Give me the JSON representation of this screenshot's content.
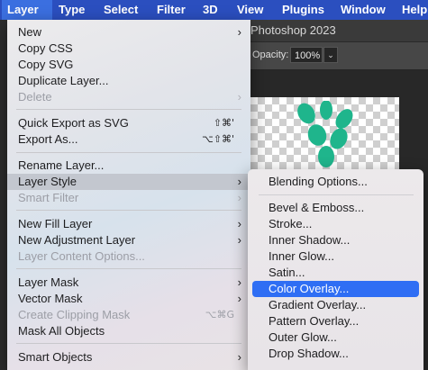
{
  "menubar": {
    "items": [
      "Layer",
      "Type",
      "Select",
      "Filter",
      "3D",
      "View",
      "Plugins",
      "Window",
      "Help"
    ]
  },
  "app": {
    "document_title": "Photoshop 2023",
    "opacity_label": "Opacity:",
    "opacity_value": "100%"
  },
  "layer_menu": {
    "new": "New",
    "copy_css": "Copy CSS",
    "copy_svg": "Copy SVG",
    "duplicate_layer": "Duplicate Layer...",
    "delete": "Delete",
    "quick_export": "Quick Export as SVG",
    "quick_export_shortcut": "⇧⌘'",
    "export_as": "Export As...",
    "export_as_shortcut": "⌥⇧⌘'",
    "rename_layer": "Rename Layer...",
    "layer_style": "Layer Style",
    "smart_filter": "Smart Filter",
    "new_fill_layer": "New Fill Layer",
    "new_adjustment_layer": "New Adjustment Layer",
    "layer_content_options": "Layer Content Options...",
    "layer_mask": "Layer Mask",
    "vector_mask": "Vector Mask",
    "create_clipping_mask": "Create Clipping Mask",
    "create_clipping_mask_shortcut": "⌥⌘G",
    "mask_all_objects": "Mask All Objects",
    "smart_objects": "Smart Objects"
  },
  "layer_style_submenu": {
    "blending_options": "Blending Options...",
    "bevel_emboss": "Bevel & Emboss...",
    "stroke": "Stroke...",
    "inner_shadow": "Inner Shadow...",
    "inner_glow": "Inner Glow...",
    "satin": "Satin...",
    "color_overlay": "Color Overlay...",
    "gradient_overlay": "Gradient Overlay...",
    "pattern_overlay": "Pattern Overlay...",
    "outer_glow": "Outer Glow...",
    "drop_shadow": "Drop Shadow..."
  },
  "colors": {
    "menubar_blue": "#2b4fbf",
    "selection_blue": "#2f6ef4",
    "leaf_green": "#1fb58c"
  }
}
